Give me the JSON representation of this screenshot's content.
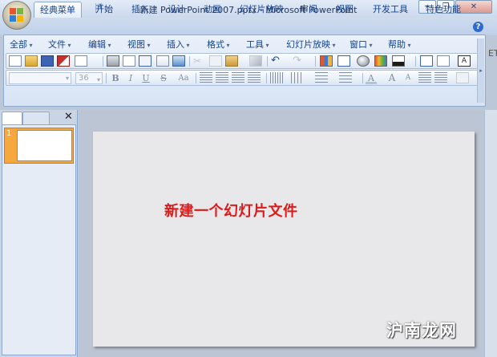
{
  "window": {
    "title": "新建 PowerPoint 2007.pptx - Microsoft PowerPoint",
    "minimize_glyph": "─",
    "restore_glyph": "❐",
    "close_glyph": "✕"
  },
  "quick_access": {
    "undo_glyph": "↶",
    "redo_glyph": "↻",
    "dropdown_glyph": "▾",
    "customize_glyph": "₹"
  },
  "tabs": [
    {
      "label": "经典菜单",
      "active": true
    },
    {
      "label": "开始"
    },
    {
      "label": "插入"
    },
    {
      "label": "设计"
    },
    {
      "label": "动画"
    },
    {
      "label": "幻灯片放映"
    },
    {
      "label": "审阅"
    },
    {
      "label": "视图"
    },
    {
      "label": "开发工具"
    },
    {
      "label": "特色功能"
    }
  ],
  "help_glyph": "?",
  "menu": [
    "全部",
    "文件",
    "编辑",
    "视图",
    "插入",
    "格式",
    "工具",
    "幻灯片放映",
    "窗口",
    "帮助"
  ],
  "format_bar": {
    "font_name": "",
    "font_size": "36",
    "buttons": [
      "B",
      "I",
      "U",
      "S",
      "Aa"
    ]
  },
  "slide_pane": {
    "close_glyph": "✕",
    "slide_number": "1"
  },
  "slide": {
    "title": "新建一个幻灯片文件"
  },
  "right_edge_text": "ET",
  "watermark": "沪南龙网",
  "colors": {
    "slide_title": "#de1919",
    "selection": "#f6a73d",
    "ribbon": "#d8e4f4",
    "workspace": "#bcc5d3"
  }
}
